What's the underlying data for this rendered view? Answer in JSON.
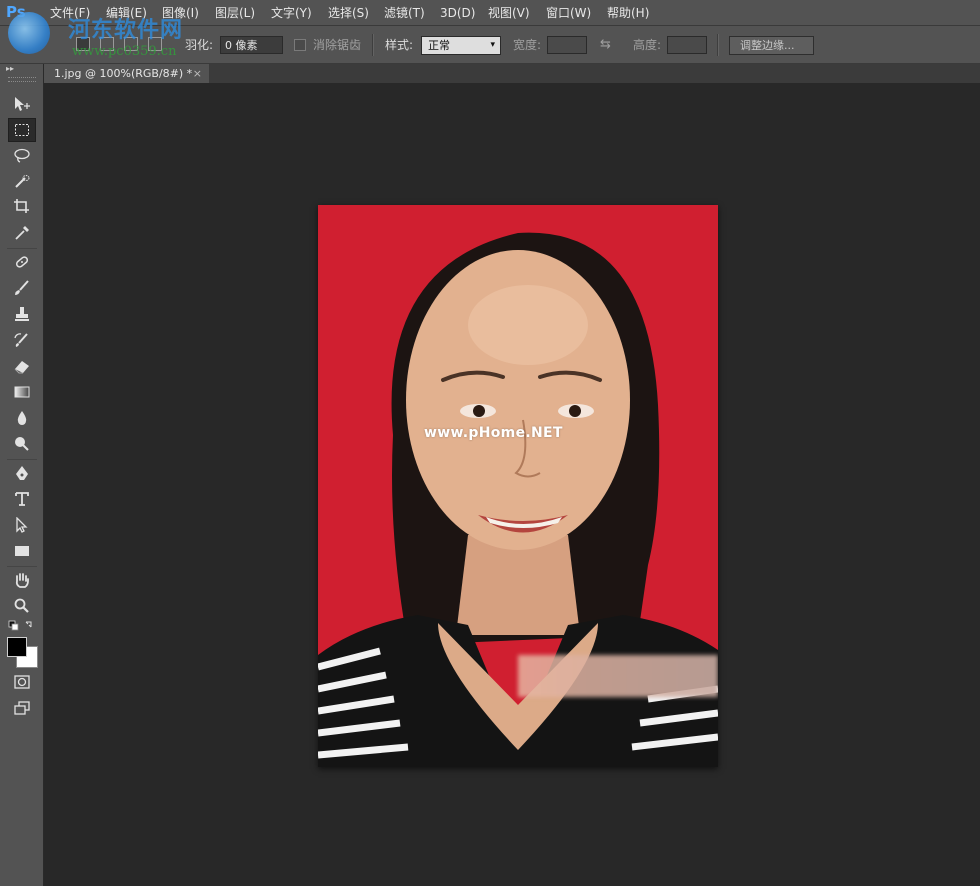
{
  "app": {
    "logo": "Ps"
  },
  "watermark": {
    "name": "河东软件网",
    "url": "www.pc0359.cn"
  },
  "menu": [
    "文件(F)",
    "编辑(E)",
    "图像(I)",
    "图层(L)",
    "文字(Y)",
    "选择(S)",
    "滤镜(T)",
    "3D(D)",
    "视图(V)",
    "窗口(W)",
    "帮助(H)"
  ],
  "options": {
    "feather_label": "羽化:",
    "feather_value": "0 像素",
    "antialias_label": "消除锯齿",
    "style_label": "样式:",
    "style_value": "正常",
    "width_label": "宽度:",
    "height_label": "高度:",
    "refine_edge_label": "调整边缘..."
  },
  "document": {
    "tab_title": "1.jpg @ 100%(RGB/8#) *",
    "close_glyph": "×",
    "photo_watermark": "www.pHome.NET"
  },
  "tools": [
    "move-tool",
    "rectangular-marquee-tool",
    "lasso-tool",
    "quick-selection-tool",
    "crop-tool",
    "eyedropper-tool",
    "spot-healing-tool",
    "brush-tool",
    "clone-stamp-tool",
    "history-brush-tool",
    "eraser-tool",
    "gradient-tool",
    "blur-tool",
    "dodge-tool",
    "pen-tool",
    "type-tool",
    "path-selection-tool",
    "rectangle-tool",
    "hand-tool",
    "zoom-tool"
  ],
  "colors": {
    "accent": "#4fa7ff",
    "photo_background": "#d01f30",
    "foreground_color": "#000000",
    "background_color": "#ffffff"
  }
}
